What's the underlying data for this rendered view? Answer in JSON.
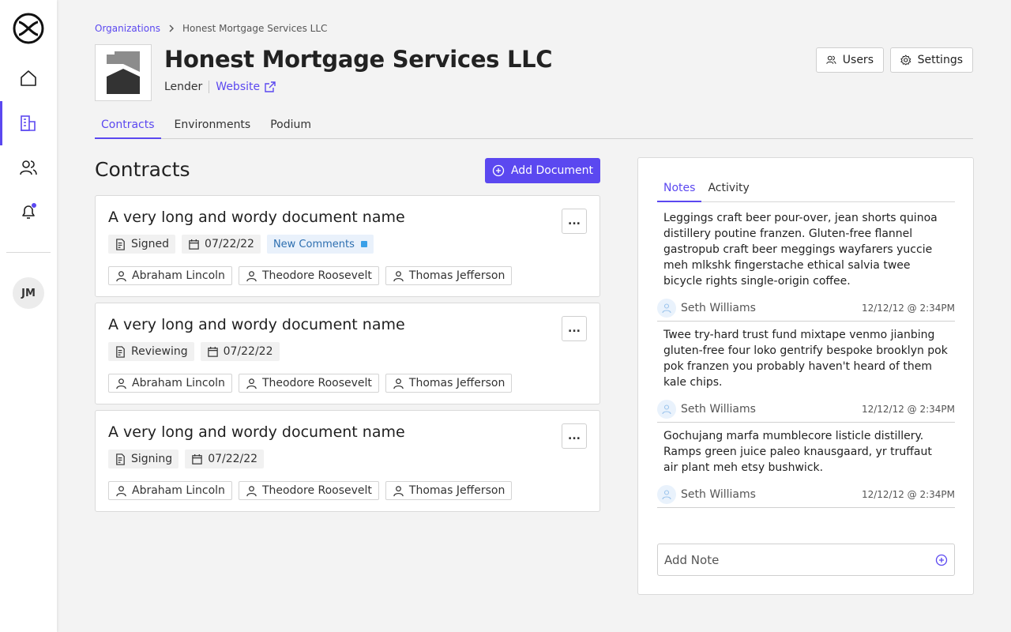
{
  "colors": {
    "accent": "#5b48f0",
    "comment_chip_bg": "#e9f1fb",
    "comment_chip_text": "#2d6fb0"
  },
  "sidebar": {
    "logo_icon": "infinity-circle-logo",
    "items": [
      {
        "name": "home",
        "icon": "home-icon",
        "active": false
      },
      {
        "name": "organizations",
        "icon": "building-icon",
        "active": true
      },
      {
        "name": "users",
        "icon": "users-icon",
        "active": false
      },
      {
        "name": "notifications",
        "icon": "bell-icon",
        "active": false,
        "has_badge": true
      }
    ],
    "avatar_initials": "JM"
  },
  "breadcrumb": {
    "parent": "Organizations",
    "current": "Honest Mortgage Services LLC"
  },
  "header": {
    "title": "Honest Mortgage Services LLC",
    "org_type": "Lender",
    "website_label": "Website",
    "users_button": "Users",
    "settings_button": "Settings"
  },
  "tabs": [
    "Contracts",
    "Environments",
    "Podium"
  ],
  "active_tab": "Contracts",
  "contracts": {
    "title": "Contracts",
    "add_button": "Add Document",
    "documents": [
      {
        "name": "A very long and wordy document name",
        "status": "Signed",
        "date": "07/22/22",
        "comments_badge": "New Comments",
        "people": [
          "Abraham Lincoln",
          "Theodore Roosevelt",
          "Thomas Jefferson"
        ]
      },
      {
        "name": "A very long and wordy document name",
        "status": "Reviewing",
        "date": "07/22/22",
        "comments_badge": null,
        "people": [
          "Abraham Lincoln",
          "Theodore Roosevelt",
          "Thomas Jefferson"
        ]
      },
      {
        "name": "A very long and wordy document name",
        "status": "Signing",
        "date": "07/22/22",
        "comments_badge": null,
        "people": [
          "Abraham Lincoln",
          "Theodore Roosevelt",
          "Thomas Jefferson"
        ]
      }
    ],
    "more_label": "..."
  },
  "notes_panel": {
    "tabs": [
      "Notes",
      "Activity"
    ],
    "active_tab": "Notes",
    "notes": [
      {
        "text": "Leggings craft beer pour-over, jean shorts quinoa distillery poutine franzen. Gluten-free flannel gastropub craft beer meggings wayfarers yuccie meh mlkshk fingerstache ethical salvia twee bicycle rights single-origin coffee.",
        "author": "Seth Williams",
        "time": "12/12/12 @ 2:34PM"
      },
      {
        "text": "Twee try-hard trust fund mixtape venmo jianbing gluten-free four loko gentrify bespoke brooklyn pok pok franzen you probably haven't heard of them kale chips.",
        "author": "Seth Williams",
        "time": "12/12/12 @ 2:34PM"
      },
      {
        "text": "Gochujang marfa mumblecore listicle distillery. Ramps green juice paleo knausgaard, yr truffaut air plant meh etsy bushwick.",
        "author": "Seth Williams",
        "time": "12/12/12 @ 2:34PM"
      }
    ],
    "add_note_placeholder": "Add Note"
  }
}
